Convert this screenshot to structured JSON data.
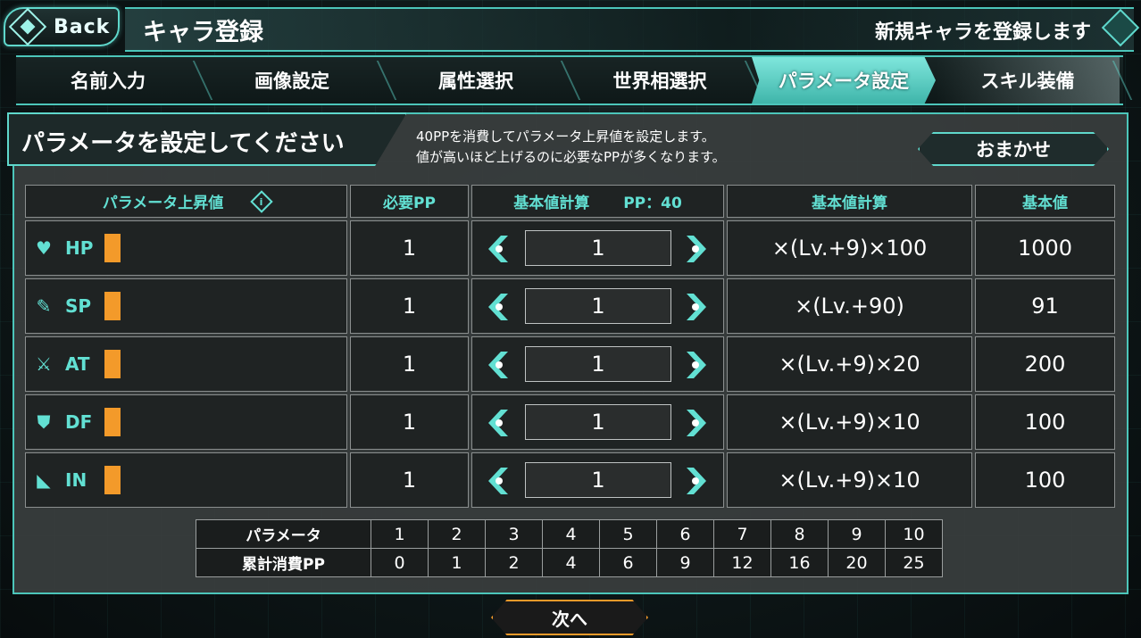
{
  "header": {
    "back_label": "Back",
    "title": "キャラ登録",
    "subtitle": "新規キャラを登録します"
  },
  "steps": [
    {
      "label": "名前入力",
      "active": false
    },
    {
      "label": "画像設定",
      "active": false
    },
    {
      "label": "属性選択",
      "active": false
    },
    {
      "label": "世界相選択",
      "active": false
    },
    {
      "label": "パラメータ設定",
      "active": true
    },
    {
      "label": "スキル装備",
      "active": false
    }
  ],
  "instruction": {
    "title": "パラメータを設定してください",
    "line1": "40PPを消費してパラメータ上昇値を設定します。",
    "line2": "値が高いほど上げるのに必要なPPが多くなります。",
    "auto_label": "おまかせ"
  },
  "table": {
    "headers": {
      "param": "パラメータ上昇値",
      "required": "必要PP",
      "calc_input": "基本値計算",
      "pp_remaining": "PP：40",
      "formula": "基本値計算",
      "base": "基本値"
    },
    "rows": [
      {
        "icon": "heart-icon",
        "stat": "HP",
        "required": "1",
        "value": "1",
        "formula": "×(Lv.+9)×100",
        "base": "1000",
        "bar_level": 0.1
      },
      {
        "icon": "sp-icon",
        "stat": "SP",
        "required": "1",
        "value": "1",
        "formula": "×(Lv.+90)",
        "base": "91",
        "bar_level": 0.1
      },
      {
        "icon": "sword-icon",
        "stat": "AT",
        "required": "1",
        "value": "1",
        "formula": "×(Lv.+9)×20",
        "base": "200",
        "bar_level": 0.1
      },
      {
        "icon": "shield-icon",
        "stat": "DF",
        "required": "1",
        "value": "1",
        "formula": "×(Lv.+9)×10",
        "base": "100",
        "bar_level": 0.1
      },
      {
        "icon": "boot-icon",
        "stat": "IN",
        "required": "1",
        "value": "1",
        "formula": "×(Lv.+9)×10",
        "base": "100",
        "bar_level": 0.1
      }
    ]
  },
  "cost_table": {
    "row1_label": "パラメータ",
    "row2_label": "累計消費PP",
    "params": [
      "1",
      "2",
      "3",
      "4",
      "5",
      "6",
      "7",
      "8",
      "9",
      "10"
    ],
    "costs": [
      "0",
      "1",
      "2",
      "4",
      "6",
      "9",
      "12",
      "16",
      "20",
      "25"
    ]
  },
  "next_label": "次へ",
  "colors": {
    "accent": "#5fd8cc",
    "label_teal": "#62e0d3",
    "bar_orange": "#f39a2a",
    "panel": "#3a3e3e"
  }
}
